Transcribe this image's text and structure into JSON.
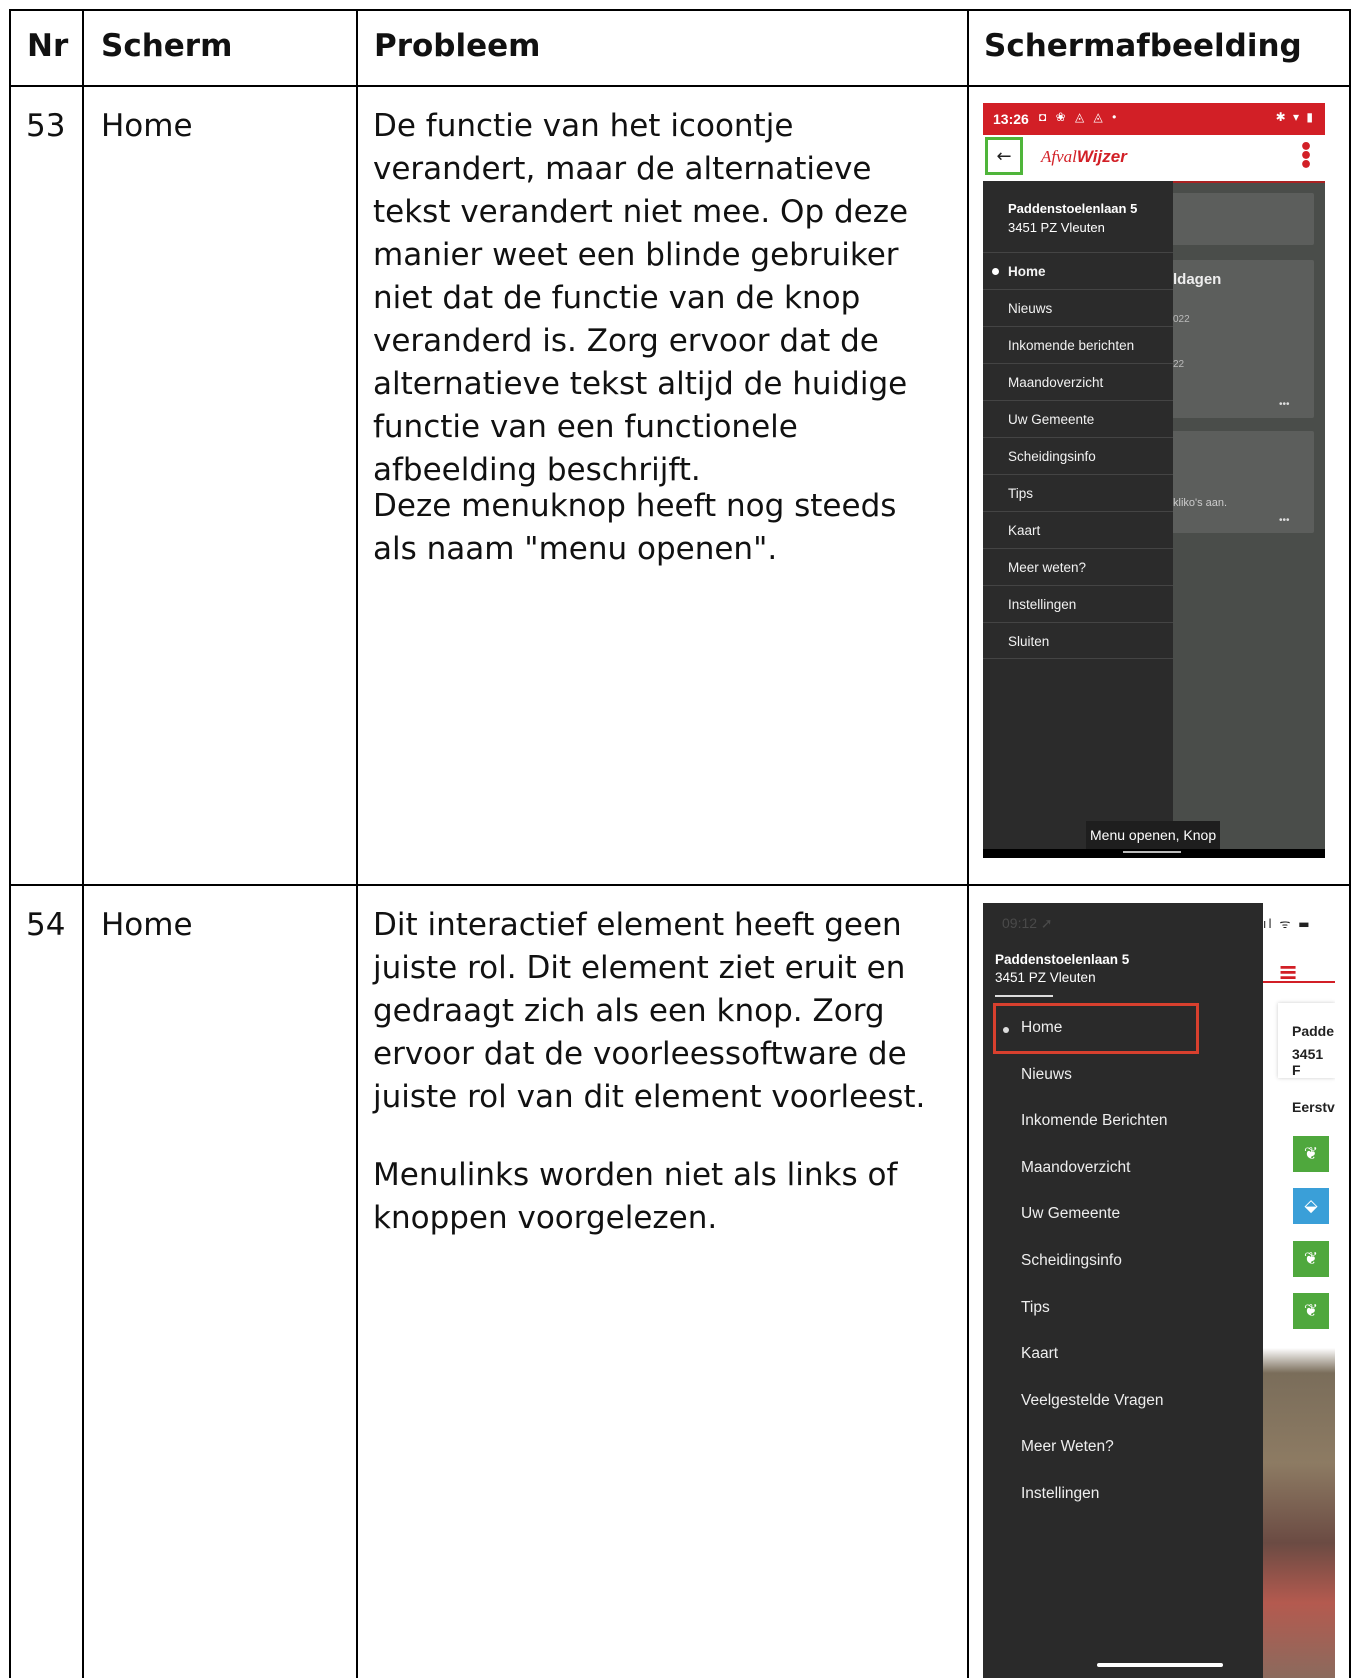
{
  "table": {
    "headers": {
      "nr": "Nr",
      "scherm": "Scherm",
      "probleem": "Probleem",
      "schermafbeelding": "Schermafbeelding"
    },
    "rows": [
      {
        "nr": "53",
        "scherm": "Home",
        "probleem_p1": "De functie van het icoontje verandert, maar de alternatieve tekst verandert niet mee. Op deze manier weet een blinde gebruiker niet dat de functie van de knop veranderd is. Zorg ervoor dat de alternatieve tekst altijd de huidige functie van een functionele afbeelding beschrijft.",
        "probleem_p2": "Deze menuknop heeft nog steeds als naam \"menu openen\"."
      },
      {
        "nr": "54",
        "scherm": "Home",
        "probleem_p1": "Dit interactief element heeft geen juiste rol. Dit element ziet eruit en gedraagt zich als een knop. Zorg ervoor dat de voorleessoftware de juiste rol van dit element voorleest.",
        "probleem_p2": "Menulinks worden niet als links of knoppen voorgelezen."
      }
    ]
  },
  "screenshot1": {
    "time": "13:26",
    "status_icons_left": "◘ ❀ ◬ ◬ •",
    "status_icons_right": "✱ ▾ ▮",
    "back_icon": "←",
    "logo_part1": "Afval",
    "logo_part2": "Wijzer",
    "overflow_icon": "⋮",
    "address_line1": "Paddenstoelenlaan 5",
    "address_line2": "3451 PZ Vleuten",
    "menu": [
      "Home",
      "Nieuws",
      "Inkomende berichten",
      "Maandoverzicht",
      "Uw Gemeente",
      "Scheidingsinfo",
      "Tips",
      "Kaart",
      "Meer weten?",
      "Instellingen",
      "Sluiten"
    ],
    "bg_text_1": "ldagen",
    "bg_text_2": "022",
    "bg_text_3": "22",
    "bg_text_4": "kliko's aan.",
    "bg_dots": "•••",
    "tooltip": "Menu openen, Knop",
    "accent_color": "#d21f26",
    "focus_color": "#4fb53a"
  },
  "screenshot2": {
    "time": "09:12 ➚",
    "status_right": "ıl ᯤ ▬",
    "address_line1": "Paddenstoelenlaan 5",
    "address_line2": "3451 PZ Vleuten",
    "menu": [
      "Home",
      "Nieuws",
      "Inkomende Berichten",
      "Maandoverzicht",
      "Uw Gemeente",
      "Scheidingsinfo",
      "Tips",
      "Kaart",
      "Veelgestelde Vragen",
      "Meer Weten?",
      "Instellingen"
    ],
    "hamburger_icon": "≡",
    "right_card_line1": "Padde",
    "right_card_line2": "3451 F",
    "right_label": "Eerstv",
    "icon_apple": "❦",
    "icon_box": "⬙",
    "highlight_color": "#d8402e"
  }
}
